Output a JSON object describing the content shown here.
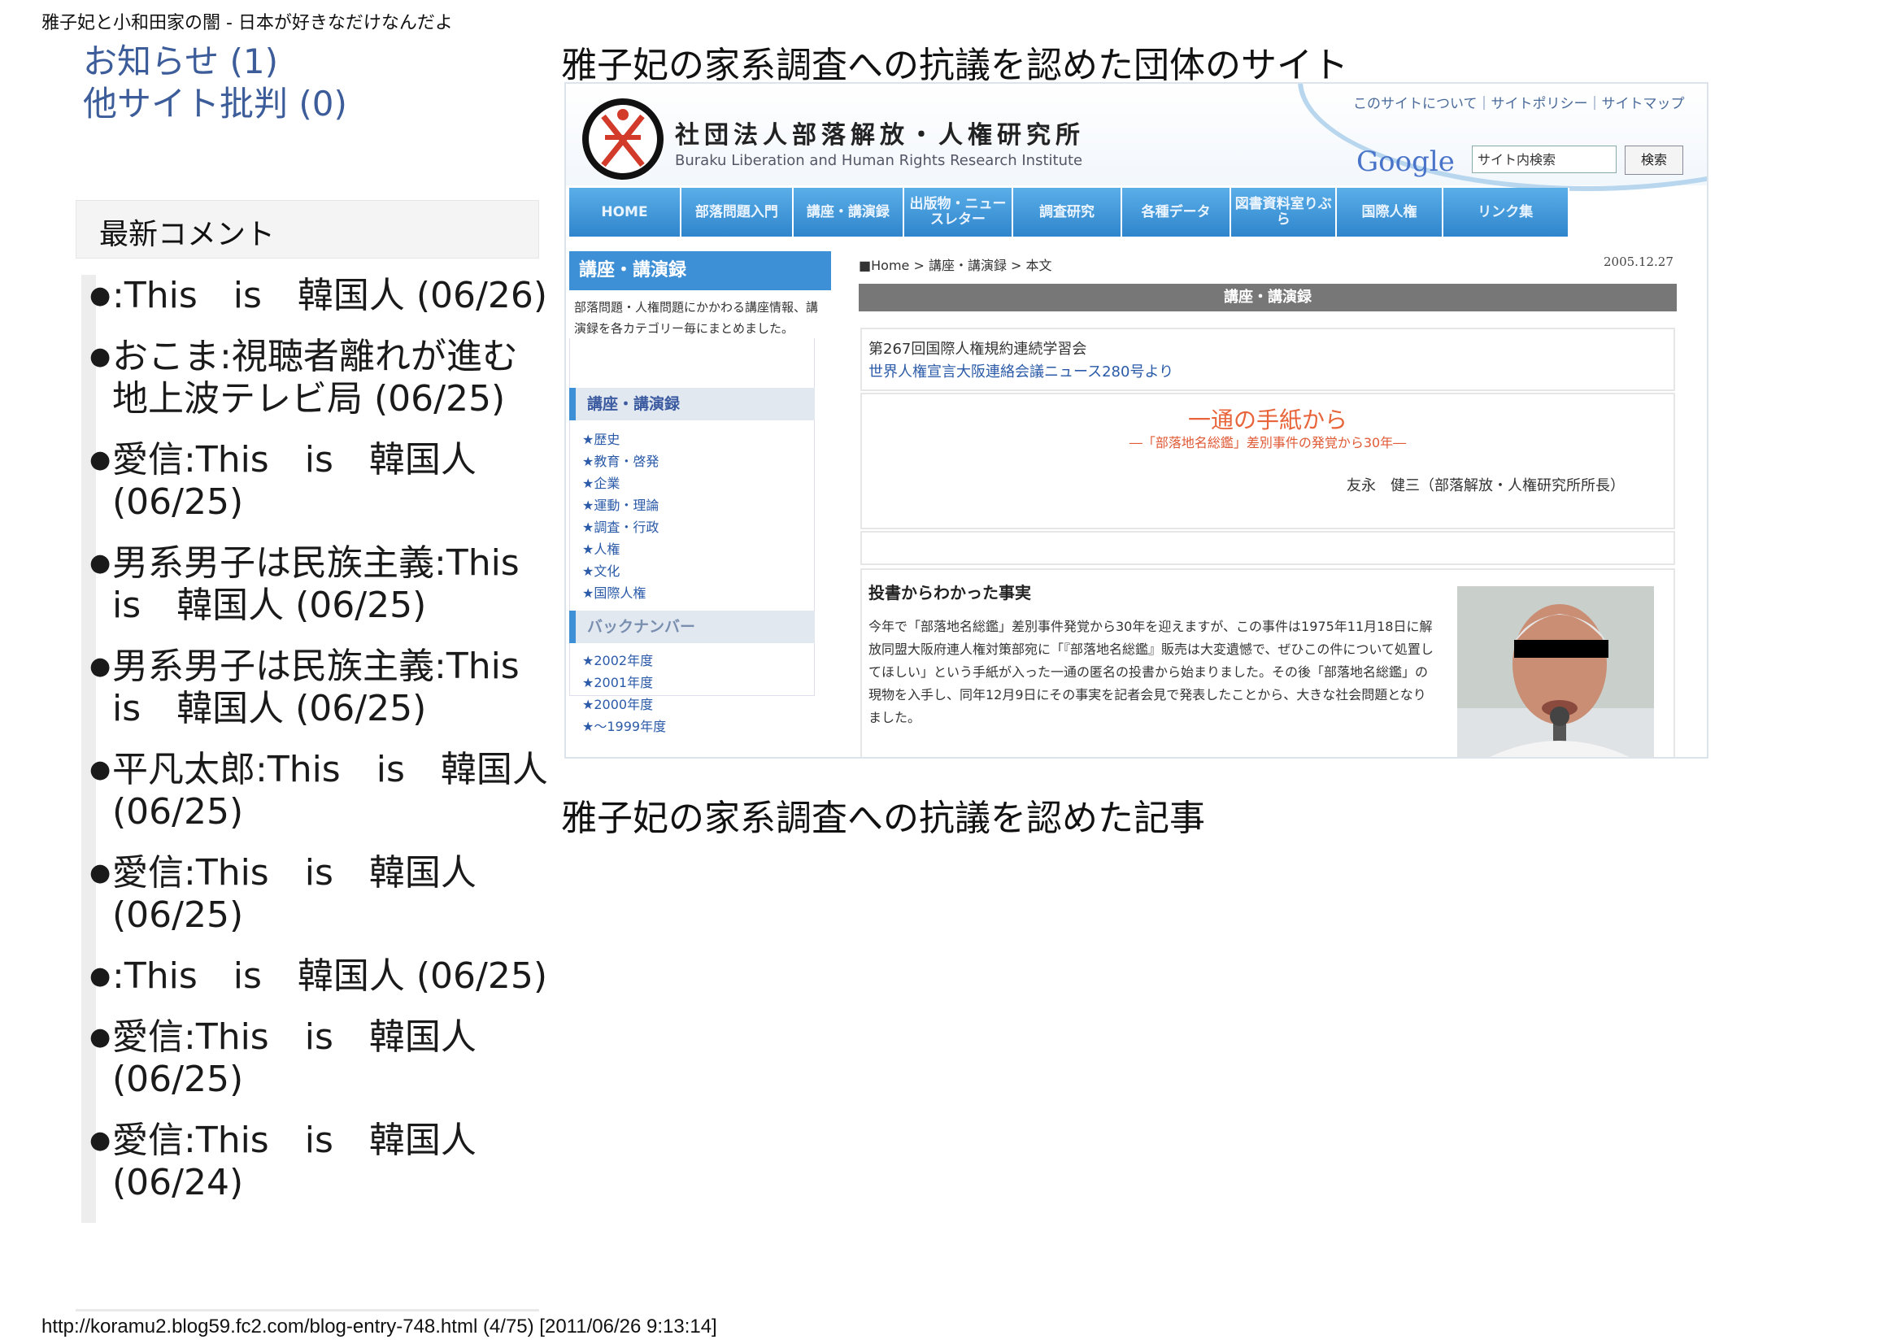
{
  "print_header": "雅子妃と小和田家の闇 - 日本が好きなだけなんだよ",
  "print_footer": "http://koramu2.blog59.fc2.com/blog-entry-748.html (4/75) [2011/06/26 9:13:14]",
  "sidebar": {
    "categories": [
      {
        "label": "お知らせ (1)"
      },
      {
        "label": "他サイト批判 (0)"
      }
    ],
    "recent_comments_title": "最新コメント",
    "recent_comments": [
      {
        "text": ":This　is　韓国人 (06/26)"
      },
      {
        "text": "おこま:視聴者離れが進む地上波テレビ局 (06/25)"
      },
      {
        "text": "愛信:This　is　韓国人 (06/25)"
      },
      {
        "text": "男系男子は民族主義:This　is　韓国人 (06/25)"
      },
      {
        "text": "男系男子は民族主義:This　is　韓国人 (06/25)"
      },
      {
        "text": "平凡太郎:This　is　韓国人 (06/25)"
      },
      {
        "text": "愛信:This　is　韓国人 (06/25)"
      },
      {
        "text": ":This　is　韓国人 (06/25)"
      },
      {
        "text": "愛信:This　is　韓国人 (06/25)"
      },
      {
        "text": "愛信:This　is　韓国人 (06/24)"
      }
    ]
  },
  "main": {
    "heading1": "雅子妃の家系調査への抗議を認めた団体のサイト",
    "heading2": "雅子妃の家系調査への抗議を認めた記事"
  },
  "screenshot": {
    "org_name_jp": "社団法人部落解放・人権研究所",
    "org_name_en": "Buraku Liberation and Human Rights Research Institute",
    "top_links": "このサイトについて｜サイトポリシー｜サイトマップ",
    "google": "Google",
    "search_placeholder": "サイト内検索",
    "search_button": "検索",
    "nav_tabs": [
      {
        "label": "HOME"
      },
      {
        "label": "部落問題入門"
      },
      {
        "label": "講座・講演録"
      },
      {
        "label": "出版物・ニュースレター"
      },
      {
        "label": "調査研究"
      },
      {
        "label": "各種データ"
      },
      {
        "label": "図書資料室りぶら"
      },
      {
        "label": "国際人権"
      },
      {
        "label": "リンク集"
      }
    ],
    "left_heading": "講座・講演録",
    "left_description": "部落問題・人権問題にかかわる講座情報、講演録を各カテゴリー毎にまとめました。",
    "left_subheading1": "講座・講演録",
    "left_categories": [
      "★歴史",
      "★教育・啓発",
      "★企業",
      "★運動・理論",
      "★調査・行政",
      "★人権",
      "★文化",
      "★国際人権"
    ],
    "left_subheading2": "バックナンバー",
    "backnumbers": [
      "★2002年度",
      "★2001年度",
      "★2000年度",
      "★〜1999年度"
    ],
    "breadcrumb": "■Home > 講座・講演録 > 本文",
    "date": "2005.12.27",
    "article_bar": "講座・講演録",
    "meeting": "第267回国際人権規約連続学習会",
    "newsletter": "世界人権宣言大阪連絡会議ニュース280号より",
    "article_title": "一通の手紙から",
    "article_subtitle": "―「部落地名総鑑」差別事件の発覚から30年―",
    "author": "友永　健三（部落解放・人権研究所所長）",
    "fact_heading": "投書からわかった事実",
    "fact_text": "今年で「部落地名総鑑」差別事件発覚から30年を迎えますが、この事件は1975年11月18日に解放同盟大阪府連人権対策部宛に「『部落地名総鑑』販売は大変遺憾で、ぜひこの件について処置してほしい」という手紙が入った一通の匿名の投書から始まりました。その後「部落地名総鑑」の現物を入手し、同年12月9日にその事実を記者会見で発表したことから、大きな社会問題となりました。",
    "colors": {
      "nav_blue": "#3d8fd6",
      "link_blue": "#2a5aa8",
      "title_orange": "#e8643a",
      "bar_gray": "#777777"
    }
  }
}
